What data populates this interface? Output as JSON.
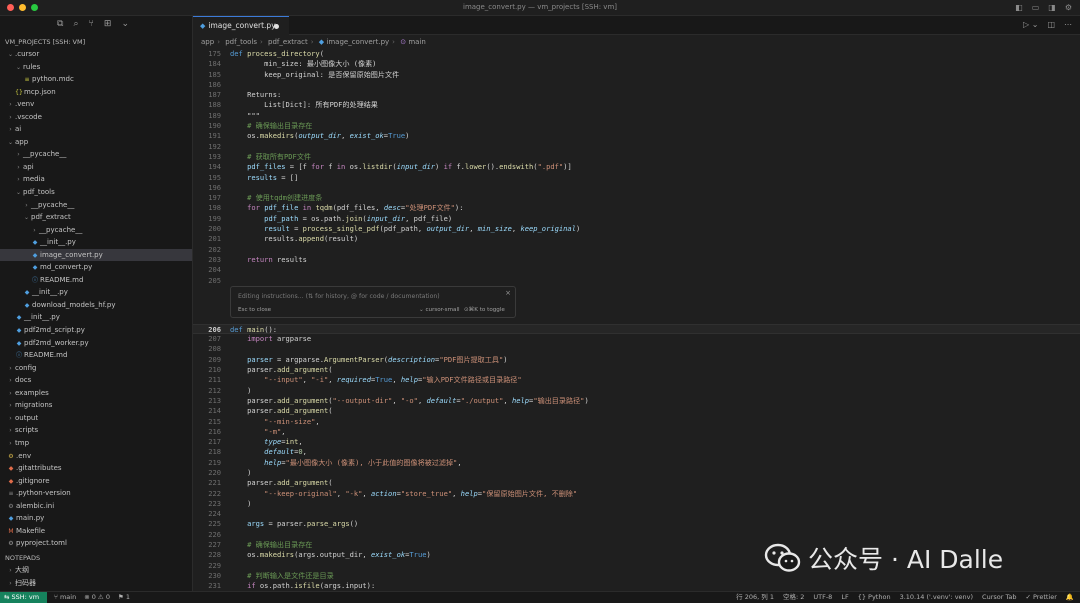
{
  "window": {
    "title": "image_convert.py — vm_projects [SSH: vm]"
  },
  "explorer": {
    "header": "VM_PROJECTS [SSH: VM]",
    "items": [
      {
        "label": ".cursor",
        "depth": 0,
        "type": "folder",
        "open": true
      },
      {
        "label": "rules",
        "depth": 1,
        "type": "folder",
        "open": true
      },
      {
        "label": "python.mdc",
        "depth": 2,
        "type": "mdc"
      },
      {
        "label": "mcp.json",
        "depth": 1,
        "type": "json"
      },
      {
        "label": ".venv",
        "depth": 0,
        "type": "folder"
      },
      {
        "label": ".vscode",
        "depth": 0,
        "type": "folder"
      },
      {
        "label": "ai",
        "depth": 0,
        "type": "folder"
      },
      {
        "label": "app",
        "depth": 0,
        "type": "folder",
        "open": true
      },
      {
        "label": "__pycache__",
        "depth": 1,
        "type": "folder"
      },
      {
        "label": "api",
        "depth": 1,
        "type": "folder"
      },
      {
        "label": "media",
        "depth": 1,
        "type": "folder"
      },
      {
        "label": "pdf_tools",
        "depth": 1,
        "type": "folder",
        "open": true
      },
      {
        "label": "__pycache__",
        "depth": 2,
        "type": "folder"
      },
      {
        "label": "pdf_extract",
        "depth": 2,
        "type": "folder",
        "open": true
      },
      {
        "label": "__pycache__",
        "depth": 3,
        "type": "folder"
      },
      {
        "label": "__init__.py",
        "depth": 3,
        "type": "py"
      },
      {
        "label": "image_convert.py",
        "depth": 3,
        "type": "py",
        "selected": true
      },
      {
        "label": "md_convert.py",
        "depth": 3,
        "type": "py"
      },
      {
        "label": "README.md",
        "depth": 3,
        "type": "md"
      },
      {
        "label": "__init__.py",
        "depth": 2,
        "type": "py"
      },
      {
        "label": "download_models_hf.py",
        "depth": 2,
        "type": "py"
      },
      {
        "label": "__init__.py",
        "depth": 1,
        "type": "py"
      },
      {
        "label": "pdf2md_script.py",
        "depth": 1,
        "type": "py"
      },
      {
        "label": "pdf2md_worker.py",
        "depth": 1,
        "type": "py"
      },
      {
        "label": "README.md",
        "depth": 1,
        "type": "md"
      },
      {
        "label": "config",
        "depth": 0,
        "type": "folder"
      },
      {
        "label": "docs",
        "depth": 0,
        "type": "folder"
      },
      {
        "label": "examples",
        "depth": 0,
        "type": "folder"
      },
      {
        "label": "migrations",
        "depth": 0,
        "type": "folder"
      },
      {
        "label": "output",
        "depth": 0,
        "type": "folder"
      },
      {
        "label": "scripts",
        "depth": 0,
        "type": "folder"
      },
      {
        "label": "tmp",
        "depth": 0,
        "type": "folder"
      },
      {
        "label": ".env",
        "depth": 0,
        "type": "env"
      },
      {
        "label": ".gitattributes",
        "depth": 0,
        "type": "git"
      },
      {
        "label": ".gitignore",
        "depth": 0,
        "type": "git"
      },
      {
        "label": ".python-version",
        "depth": 0,
        "type": "txt"
      },
      {
        "label": "alembic.ini",
        "depth": 0,
        "type": "ini"
      },
      {
        "label": "main.py",
        "depth": 0,
        "type": "py"
      },
      {
        "label": "Makefile",
        "depth": 0,
        "type": "make"
      },
      {
        "label": "pyproject.toml",
        "depth": 0,
        "type": "toml"
      }
    ],
    "notepads_header": "NOTEPADS",
    "notepads": [
      "大纲",
      "扫码器"
    ]
  },
  "tab": {
    "label": "image_convert.py"
  },
  "breadcrumb": [
    "app",
    "pdf_tools",
    "pdf_extract",
    "image_convert.py",
    "main"
  ],
  "code_top": [
    {
      "n": "175",
      "h": "<span class='k'>def</span> <span class='f'>process_directory</span>("
    },
    {
      "n": "184",
      "h": "        min_size: 最小图像大小 (像素)"
    },
    {
      "n": "185",
      "h": "        keep_original: 是否保留原始图片文件"
    },
    {
      "n": "186",
      "h": ""
    },
    {
      "n": "187",
      "h": "    Returns:"
    },
    {
      "n": "188",
      "h": "        List[Dict]: 所有PDF的处理结果"
    },
    {
      "n": "189",
      "h": "    \"\"\""
    },
    {
      "n": "190",
      "h": "    <span class='c'># 确保输出目录存在</span>"
    },
    {
      "n": "191",
      "h": "    os.<span class='f'>makedirs</span>(<span class='i'>output_dir</span>, <span class='i'>exist_ok</span>=<span class='b'>True</span>)"
    },
    {
      "n": "192",
      "h": ""
    },
    {
      "n": "193",
      "h": "    <span class='c'># 获取所有PDF文件</span>"
    },
    {
      "n": "194",
      "h": "    <span class='p'>pdf_files</span> = [f <span class='kw'>for</span> f <span class='kw'>in</span> os.<span class='f'>listdir</span>(<span class='i'>input_dir</span>) <span class='kw'>if</span> f.<span class='f'>lower</span>().<span class='f'>endswith</span>(<span class='s'>\".pdf\"</span>)]"
    },
    {
      "n": "195",
      "h": "    <span class='p'>results</span> = []"
    },
    {
      "n": "196",
      "h": ""
    },
    {
      "n": "197",
      "h": "    <span class='c'># 使用tqdm创建进度条</span>"
    },
    {
      "n": "198",
      "h": "    <span class='kw'>for</span> <span class='p'>pdf_file</span> <span class='kw'>in</span> <span class='f'>tqdm</span>(pdf_files, <span class='i'>desc</span>=<span class='s'>\"处理PDF文件\"</span>):"
    },
    {
      "n": "199",
      "h": "        <span class='p'>pdf_path</span> = os.path.<span class='f'>join</span>(<span class='i'>input_dir</span>, pdf_file)"
    },
    {
      "n": "200",
      "h": "        <span class='p'>result</span> = <span class='f'>process_single_pdf</span>(pdf_path, <span class='i'>output_dir</span>, <span class='i'>min_size</span>, <span class='i'>keep_original</span>)"
    },
    {
      "n": "201",
      "h": "        results.<span class='f'>append</span>(result)"
    },
    {
      "n": "202",
      "h": ""
    },
    {
      "n": "203",
      "h": "    <span class='kw'>return</span> results"
    },
    {
      "n": "204",
      "h": ""
    },
    {
      "n": "205",
      "h": ""
    }
  ],
  "code_bottom": [
    {
      "n": "206",
      "h": "<span class='k'>def</span> <span class='f'>main</span>():",
      "cur": true
    },
    {
      "n": "207",
      "h": "    <span class='kw'>import</span> argparse"
    },
    {
      "n": "208",
      "h": ""
    },
    {
      "n": "209",
      "h": "    <span class='p'>parser</span> = argparse.<span class='f'>ArgumentParser</span>(<span class='i'>description</span>=<span class='s'>\"PDF图片提取工具\"</span>)"
    },
    {
      "n": "210",
      "h": "    parser.<span class='f'>add_argument</span>("
    },
    {
      "n": "211",
      "h": "        <span class='s'>\"--input\"</span>, <span class='s'>\"-i\"</span>, <span class='i'>required</span>=<span class='b'>True</span>, <span class='i'>help</span>=<span class='s'>\"输入PDF文件路径或目录路径\"</span>"
    },
    {
      "n": "212",
      "h": "    )"
    },
    {
      "n": "213",
      "h": "    parser.<span class='f'>add_argument</span>(<span class='s'>\"--output-dir\"</span>, <span class='s'>\"-o\"</span>, <span class='i'>default</span>=<span class='s'>\"./output\"</span>, <span class='i'>help</span>=<span class='s'>\"输出目录路径\"</span>)"
    },
    {
      "n": "214",
      "h": "    parser.<span class='f'>add_argument</span>("
    },
    {
      "n": "215",
      "h": "        <span class='s'>\"--min-size\"</span>,"
    },
    {
      "n": "216",
      "h": "        <span class='s'>\"-m\"</span>,"
    },
    {
      "n": "217",
      "h": "        <span class='i'>type</span>=<span class='f'>int</span>,"
    },
    {
      "n": "218",
      "h": "        <span class='i'>default</span>=<span class='n'>0</span>,"
    },
    {
      "n": "219",
      "h": "        <span class='i'>help</span>=<span class='s'>\"最小图像大小 (像素), 小于此值的图像将被过滤掉\"</span>,"
    },
    {
      "n": "220",
      "h": "    )"
    },
    {
      "n": "221",
      "h": "    parser.<span class='f'>add_argument</span>("
    },
    {
      "n": "222",
      "h": "        <span class='s'>\"--keep-original\"</span>, <span class='s'>\"-k\"</span>, <span class='i'>action</span>=<span class='s'>\"store_true\"</span>, <span class='i'>help</span>=<span class='s'>\"保留原始图片文件, 不删除\"</span>"
    },
    {
      "n": "223",
      "h": "    )"
    },
    {
      "n": "224",
      "h": ""
    },
    {
      "n": "225",
      "h": "    <span class='p'>args</span> = parser.<span class='f'>parse_args</span>()"
    },
    {
      "n": "226",
      "h": ""
    },
    {
      "n": "227",
      "h": "    <span class='c'># 确保输出目录存在</span>"
    },
    {
      "n": "228",
      "h": "    os.<span class='f'>makedirs</span>(args.output_dir, <span class='i'>exist_ok</span>=<span class='b'>True</span>)"
    },
    {
      "n": "229",
      "h": ""
    },
    {
      "n": "230",
      "h": "    <span class='c'># 判断输入是文件还是目录</span>"
    },
    {
      "n": "231",
      "h": "    <span class='kw'>if</span> os.path.<span class='f'>isfile</span>(args.input):"
    }
  ],
  "inline_edit": {
    "placeholder": "Editing instructions... (⇅ for history, @ for code / documentation)",
    "hint": "Esc to close",
    "model": "⌄ cursor-small",
    "toggle": "⊙⌘K to toggle"
  },
  "status": {
    "remote": "SSH: vm",
    "branch": "main",
    "problems": "⊗ 0 ⚠ 0",
    "ports": "⚑ 1",
    "position": "行 206, 列 1",
    "spaces": "空格: 2",
    "encoding": "UTF-8",
    "eol": "LF",
    "language": "{} Python",
    "interpreter": "3.10.14 ('.venv': venv)",
    "tab": "Cursor Tab",
    "formatter": "✓ Prettier"
  },
  "watermark": {
    "text": "公众号 · AI Dalle"
  },
  "colors": {
    "accent": "#3c7bd9",
    "remote_bg": "#16825d",
    "selection": "#37373d"
  }
}
